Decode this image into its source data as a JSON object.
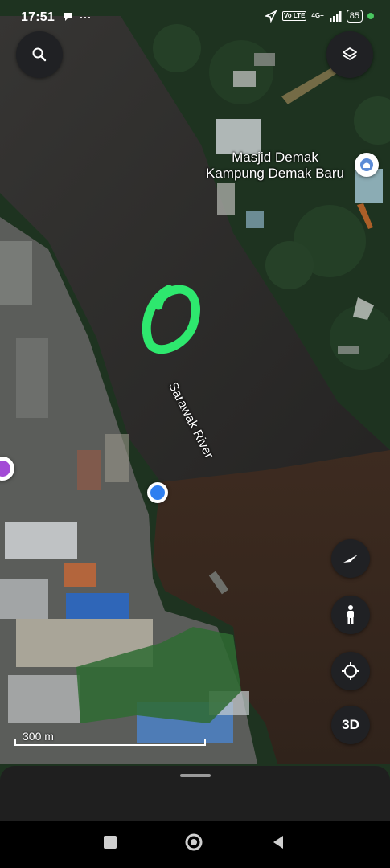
{
  "status_bar": {
    "time": "17:51",
    "left_icons": [
      "chat-bubble-icon",
      "more-dots-icon"
    ],
    "right_icons": [
      "location-arrow-icon",
      "volte-icon",
      "signal-icon"
    ],
    "network": "4G+",
    "volte": "Vo LTE",
    "battery": "85",
    "indicator_color": "#4ac760"
  },
  "map": {
    "poi_label": "Masjid Demak\nKampung Demak Baru",
    "river_label": "Sarawak River",
    "scale_label": "300 m",
    "colors": {
      "river_upper": "#2c2b2a",
      "river_lower": "#3b2a21",
      "forest": "#1f3a22",
      "user_location": "#2f7ff0",
      "annotation": "#2ee86e"
    }
  },
  "controls": {
    "search": "search-icon",
    "layers": "layers-icon",
    "compass": "compass-icon",
    "street_view": "pegman-icon",
    "my_location": "my-location-icon",
    "three_d": "3D"
  },
  "nav_bar": [
    "recent-apps-icon",
    "home-icon",
    "back-icon"
  ]
}
